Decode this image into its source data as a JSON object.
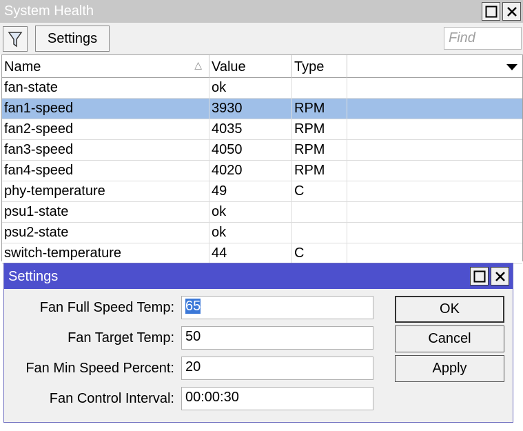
{
  "window": {
    "title": "System Health"
  },
  "toolbar": {
    "filter_icon": "filter-funnel-icon",
    "settings_label": "Settings",
    "find_placeholder": "Find"
  },
  "table": {
    "columns": [
      "Name",
      "Value",
      "Type"
    ],
    "sorted_column": "Name",
    "rows": [
      {
        "name": "fan-state",
        "value": "ok",
        "type": ""
      },
      {
        "name": "fan1-speed",
        "value": "3930",
        "type": "RPM"
      },
      {
        "name": "fan2-speed",
        "value": "4035",
        "type": "RPM"
      },
      {
        "name": "fan3-speed",
        "value": "4050",
        "type": "RPM"
      },
      {
        "name": "fan4-speed",
        "value": "4020",
        "type": "RPM"
      },
      {
        "name": "phy-temperature",
        "value": "49",
        "type": "C"
      },
      {
        "name": "psu1-state",
        "value": "ok",
        "type": ""
      },
      {
        "name": "psu2-state",
        "value": "ok",
        "type": ""
      },
      {
        "name": "switch-temperature",
        "value": "44",
        "type": "C"
      }
    ],
    "selected_row": "fan1-speed"
  },
  "dialog": {
    "title": "Settings",
    "fields": [
      {
        "label": "Fan Full Speed Temp:",
        "value": "65"
      },
      {
        "label": "Fan Target Temp:",
        "value": "50"
      },
      {
        "label": "Fan Min Speed Percent:",
        "value": "20"
      },
      {
        "label": "Fan Control Interval:",
        "value": "00:00:30"
      }
    ],
    "buttons": {
      "ok": "OK",
      "cancel": "Cancel",
      "apply": "Apply"
    }
  },
  "colors": {
    "main_titlebar": "#c8c8c8",
    "dialog_titlebar": "#4d50cd",
    "selected_row": "#9fbfe8",
    "text_selection": "#3b78d8"
  }
}
